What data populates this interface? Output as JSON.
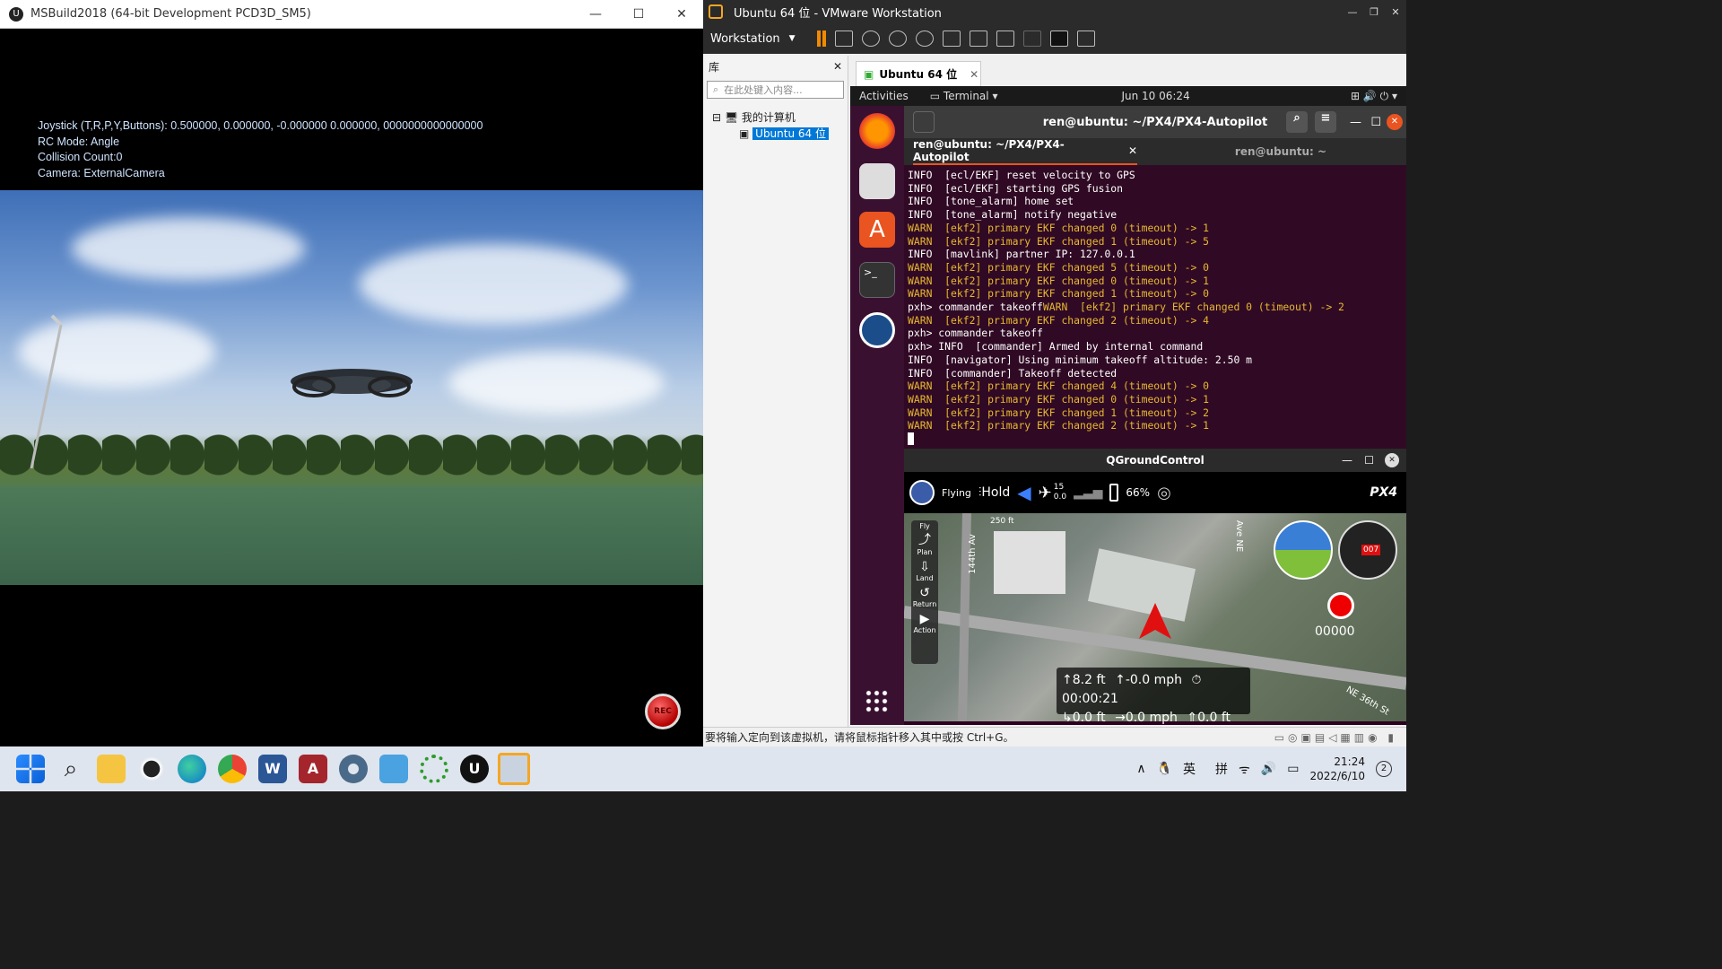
{
  "ue_window": {
    "title": "MSBuild2018 (64-bit Development PCD3D_SM5)",
    "hud": {
      "joystick": "Joystick (T,R,P,Y,Buttons): 0.500000, 0.000000, -0.000000 0.000000, 0000000000000000",
      "rc_mode": "RC Mode: Angle",
      "collision": "Collision Count:0",
      "camera": "Camera: ExternalCamera"
    },
    "rec_label": "REC"
  },
  "vmware": {
    "title": "Ubuntu 64 位 - VMware Workstation",
    "menu_label": "Workstation",
    "library": {
      "header": "库",
      "search_placeholder": "在此处键入内容...",
      "tree_root": "我的计算机",
      "tree_child": "Ubuntu 64 位"
    },
    "tab_label": "Ubuntu 64 位",
    "status_text": "要将输入定向到该虚拟机，请将鼠标指针移入其中或按 Ctrl+G。"
  },
  "gnome": {
    "activities": "Activities",
    "app_menu": "Terminal",
    "datetime": "Jun 10  06:24"
  },
  "terminal": {
    "title": "ren@ubuntu: ~/PX4/PX4-Autopilot",
    "tabs": [
      "ren@ubuntu: ~/PX4/PX4-Autopilot",
      "ren@ubuntu: ~"
    ],
    "lines": [
      {
        "level": "info",
        "text": "INFO  [ecl/EKF] reset velocity to GPS"
      },
      {
        "level": "info",
        "text": "INFO  [ecl/EKF] starting GPS fusion"
      },
      {
        "level": "info",
        "text": "INFO  [tone_alarm] home set"
      },
      {
        "level": "info",
        "text": "INFO  [tone_alarm] notify negative"
      },
      {
        "level": "warn",
        "text": "WARN  [ekf2] primary EKF changed 0 (timeout) -> 1"
      },
      {
        "level": "warn",
        "text": "WARN  [ekf2] primary EKF changed 1 (timeout) -> 5"
      },
      {
        "level": "info",
        "text": "INFO  [mavlink] partner IP: 127.0.0.1"
      },
      {
        "level": "warn",
        "text": "WARN  [ekf2] primary EKF changed 5 (timeout) -> 0"
      },
      {
        "level": "warn",
        "text": "WARN  [ekf2] primary EKF changed 0 (timeout) -> 1"
      },
      {
        "level": "warn",
        "text": "WARN  [ekf2] primary EKF changed 1 (timeout) -> 0"
      },
      {
        "level": "mixed",
        "text": "pxh> commander takeoff",
        "warn_part": "WARN  [ekf2] primary EKF changed 0 (timeout) -> 2"
      },
      {
        "level": "warn",
        "text": "WARN  [ekf2] primary EKF changed 2 (timeout) -> 4"
      },
      {
        "level": "info",
        "text": "pxh> commander takeoff"
      },
      {
        "level": "info",
        "text": "pxh> INFO  [commander] Armed by internal command"
      },
      {
        "level": "info",
        "text": "INFO  [navigator] Using minimum takeoff altitude: 2.50 m"
      },
      {
        "level": "info",
        "text": "INFO  [commander] Takeoff detected"
      },
      {
        "level": "warn",
        "text": "WARN  [ekf2] primary EKF changed 4 (timeout) -> 0"
      },
      {
        "level": "warn",
        "text": "WARN  [ekf2] primary EKF changed 0 (timeout) -> 1"
      },
      {
        "level": "warn",
        "text": "WARN  [ekf2] primary EKF changed 1 (timeout) -> 2"
      },
      {
        "level": "warn",
        "text": "WARN  [ekf2] primary EKF changed 2 (timeout) -> 1"
      }
    ]
  },
  "qgc": {
    "title": "QGroundControl",
    "flight_state": "Flying",
    "mode": "Hold",
    "sats": "15",
    "hdop": "0.0",
    "battery": "66%",
    "brand": "PX4",
    "tools": [
      "Fly",
      "Plan",
      "Land",
      "Return",
      "Action"
    ],
    "map_labels": [
      "144th Av",
      "Ave NE",
      "NE 36th St",
      "250 ft"
    ],
    "telemetry": {
      "alt": "8.2 ft",
      "vspeed": "-0.0 mph",
      "time": "00:00:21",
      "dist": "0.0 ft",
      "hspeed": "0.0 mph",
      "home": "0.0 ft"
    },
    "heading": "007",
    "counter": "00000"
  },
  "taskbar": {
    "ime1": "英",
    "ime2": "拼",
    "time": "21:24",
    "date": "2022/6/10",
    "notif_count": "2"
  }
}
